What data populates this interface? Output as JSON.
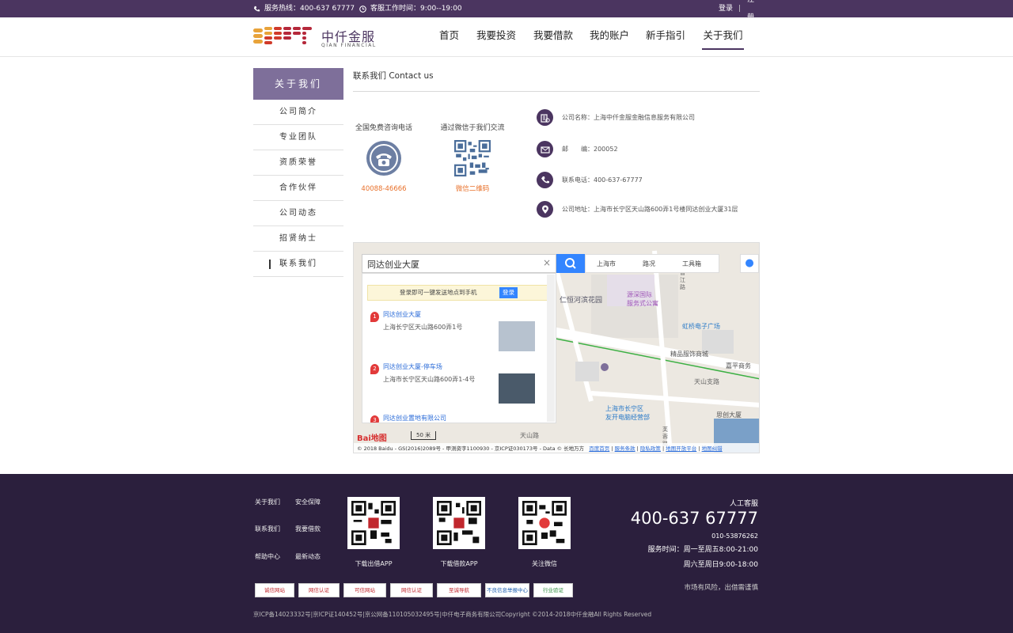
{
  "topbar": {
    "hotline": "服务热线：400-637 67777",
    "service_time": "客服工作时间：9:00--19:00",
    "login": "登录",
    "divider": "|",
    "register": "注册"
  },
  "logo": {
    "cn": "中仟金服",
    "en": "QIAN FINANCIAL"
  },
  "nav": {
    "items": [
      {
        "label": "首页"
      },
      {
        "label": "我要投资"
      },
      {
        "label": "我要借款"
      },
      {
        "label": "我的账户"
      },
      {
        "label": "新手指引"
      },
      {
        "label": "关于我们"
      }
    ],
    "active_index": 5
  },
  "sidebar": {
    "title": "关于我们",
    "items": [
      {
        "label": "公司简介"
      },
      {
        "label": "专业团队"
      },
      {
        "label": "资质荣誉"
      },
      {
        "label": "合作伙伴"
      },
      {
        "label": "公司动态"
      },
      {
        "label": "招贤纳士"
      },
      {
        "label": "联系我们"
      }
    ],
    "active_index": 6
  },
  "content": {
    "title": "联系我们 Contact us",
    "phone_label": "全国免费咨询电话",
    "phone_value": "40088-46666",
    "wechat_label": "通过微信于我们交流",
    "wechat_value": "微信二维码",
    "info": [
      {
        "icon": "company-icon",
        "text": "公司名称：上海中仟金服金融信息服务有限公司"
      },
      {
        "icon": "mail-icon",
        "text": "邮　　编：200052"
      },
      {
        "icon": "phone-icon",
        "text": "联系电话：400-637-67777"
      },
      {
        "icon": "location-icon",
        "text": "公司地址：上海市长宁区天山路600弄1号楼同达创业大厦31层"
      }
    ]
  },
  "map": {
    "search_value": "同达创业大厦",
    "city": "上海市",
    "route": "路况",
    "toolbox": "工具箱",
    "login_tip": "登录即可一键发送地点到手机",
    "login_btn": "登录",
    "results": [
      {
        "num": "1",
        "name": "同达创业大厦",
        "addr": "上海长宁区天山路600弄1号"
      },
      {
        "num": "2",
        "name": "同达创业大厦-停车场",
        "addr": "上海市长宁区天山路600弄1-4号"
      },
      {
        "num": "3",
        "name": "同达创业置地有限公司",
        "addr": ""
      }
    ],
    "labels": [
      {
        "text": "仁恒河滨花园"
      },
      {
        "text": "源深国际\n服务式公寓"
      },
      {
        "text": "虹桥电子广场"
      },
      {
        "text": "精品服饰商城"
      },
      {
        "text": "嘉平商务"
      },
      {
        "text": "天山支路"
      },
      {
        "text": "上海市长宁区\n友开电脑经营部"
      },
      {
        "text": "天山路"
      },
      {
        "text": "思创大厦"
      },
      {
        "text": "普江路"
      },
      {
        "text": "芙蓉路"
      }
    ],
    "scale": "50 米",
    "logo": "Bai地图",
    "copyright": "© 2018 Baidu - GS(2016)2089号 - 甲测资字1100930 - 京ICP证030173号 - Data © 长地万方",
    "links": [
      "百度首页",
      "服务条款",
      "隐私政策",
      "地图开放平台",
      "地图纠错"
    ]
  },
  "footer": {
    "links": [
      "关于我们",
      "安全保障",
      "联系我们",
      "我要借款",
      "帮助中心",
      "最新动态"
    ],
    "qrs": [
      {
        "caption": "下载出借APP"
      },
      {
        "caption": "下载借款APP"
      },
      {
        "caption": "关注微信"
      }
    ],
    "service_title": "人工客服",
    "big_phone": "400-637 67777",
    "small_phone": "010-53876262",
    "hours1": "服务时间：周一至周五8:00-21:00",
    "hours2": "周六至周日9:00-18:00",
    "risk": "市场有风险，出借需谨慎",
    "badges": [
      "诚信网站",
      "网信认证",
      "可信网站",
      "网信认证",
      "至诚导航",
      "不良信息举报中心",
      "行业验证"
    ],
    "copyright": "京ICP备14023332号|京ICP证140452号|京公网备110105032495号|中仟电子商务有限公司Copyright ©2014-2018中仟金融All Rights Reserved"
  },
  "colors": {
    "brand": "#4b3560",
    "sidebar_title": "#7e6f9a",
    "accent": "#e8702a",
    "footer": "#2b1f3d",
    "map_blue": "#3385ff"
  }
}
